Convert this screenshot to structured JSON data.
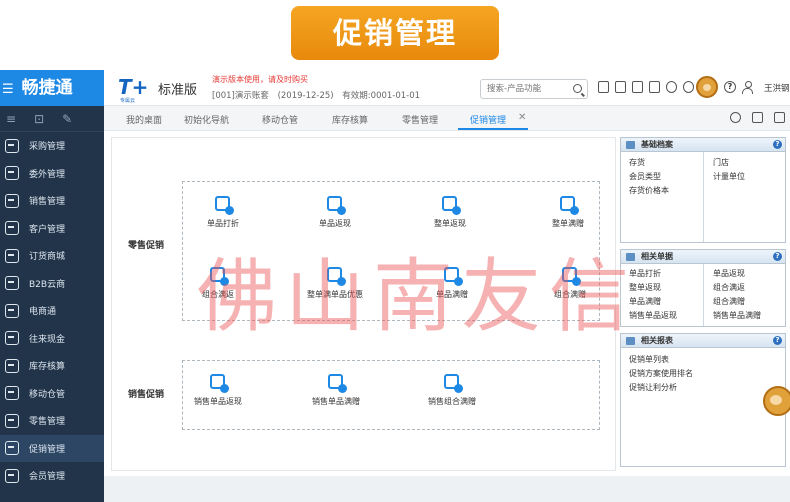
{
  "banner": {
    "title": "促销管理"
  },
  "sidebar": {
    "logo": "畅捷通",
    "items": [
      {
        "label": "采购管理"
      },
      {
        "label": "委外管理"
      },
      {
        "label": "销售管理"
      },
      {
        "label": "客户管理"
      },
      {
        "label": "订货商城"
      },
      {
        "label": "B2B云商"
      },
      {
        "label": "电商通"
      },
      {
        "label": "往来现金"
      },
      {
        "label": "库存核算"
      },
      {
        "label": "移动仓管"
      },
      {
        "label": "零售管理"
      },
      {
        "label": "促销管理"
      },
      {
        "label": "会员管理"
      }
    ]
  },
  "header": {
    "logo": "T+",
    "logo_sub": "专属云",
    "edition": "标准版",
    "warning": "演示版本使用，请及时购买",
    "account_name": "[001]演示账套",
    "account_date": "(2019-12-25)",
    "validity": "有效期:0001-01-01",
    "search_placeholder": "搜索-产品功能",
    "username": "王洪钢"
  },
  "tabs": [
    {
      "label": "我的桌面"
    },
    {
      "label": "初始化导航"
    },
    {
      "label": "移动仓管"
    },
    {
      "label": "库存核算"
    },
    {
      "label": "零售管理"
    },
    {
      "label": "促销管理",
      "active": true
    }
  ],
  "retail_section": {
    "label": "零售促销",
    "features": [
      {
        "label": "单品打折"
      },
      {
        "label": "单品返现"
      },
      {
        "label": "整单返现"
      },
      {
        "label": "整单满赠"
      },
      {
        "label": "组合满返"
      },
      {
        "label": "整单满单品优惠"
      },
      {
        "label": "单品满赠"
      },
      {
        "label": "组合满赠"
      }
    ]
  },
  "sales_section": {
    "label": "销售促销",
    "features": [
      {
        "label": "销售单品返现"
      },
      {
        "label": "销售单品满赠"
      },
      {
        "label": "销售组合满赠"
      }
    ]
  },
  "panels": {
    "basic": {
      "title": "基础档案",
      "left": [
        "存货",
        "会员类型",
        "存货价格本"
      ],
      "right": [
        "门店",
        "计量单位"
      ]
    },
    "docs": {
      "title": "相关单据",
      "left": [
        "单品打折",
        "整单返现",
        "单品满赠",
        "销售单品返现"
      ],
      "right": [
        "单品返现",
        "组合满返",
        "组合满赠",
        "销售单品满赠"
      ]
    },
    "reports": {
      "title": "相关报表",
      "items": [
        "促销单列表",
        "促销方案使用排名",
        "促销让利分析"
      ]
    }
  },
  "watermark": "佛山南友信"
}
